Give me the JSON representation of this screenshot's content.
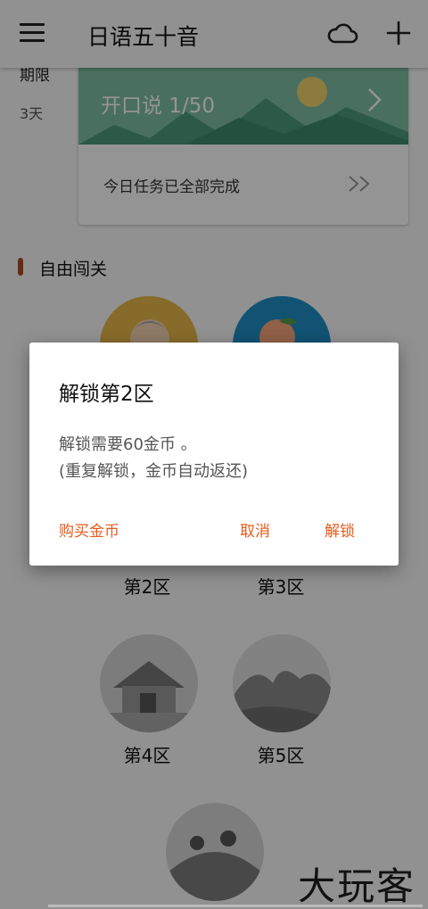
{
  "appbar": {
    "title": "日语五十音",
    "menu_icon": "menu-icon",
    "cloud_icon": "cloud-icon",
    "add_icon": "plus-icon"
  },
  "summary": {
    "limit_label": "期限",
    "limit_value": "3天"
  },
  "speaking_card": {
    "banner_text": "开口说 1/50",
    "task_text": "今日任务已全部完成"
  },
  "free_mode": {
    "title": "自由闯关",
    "zones": [
      {
        "name": "第2区"
      },
      {
        "name": "第3区"
      },
      {
        "name": "第4区"
      },
      {
        "name": "第5区"
      }
    ]
  },
  "dialog": {
    "title": "解锁第2区",
    "message_line1": "解锁需要60金币 。",
    "message_line2": "(重复解锁，金币自动返还)",
    "buy_label": "购买金币",
    "cancel_label": "取消",
    "unlock_label": "解锁"
  },
  "watermark": "大玩客",
  "colors": {
    "accent": "#e85a1c",
    "section_bar": "#b14a1e",
    "banner": "#7fc0a6"
  }
}
